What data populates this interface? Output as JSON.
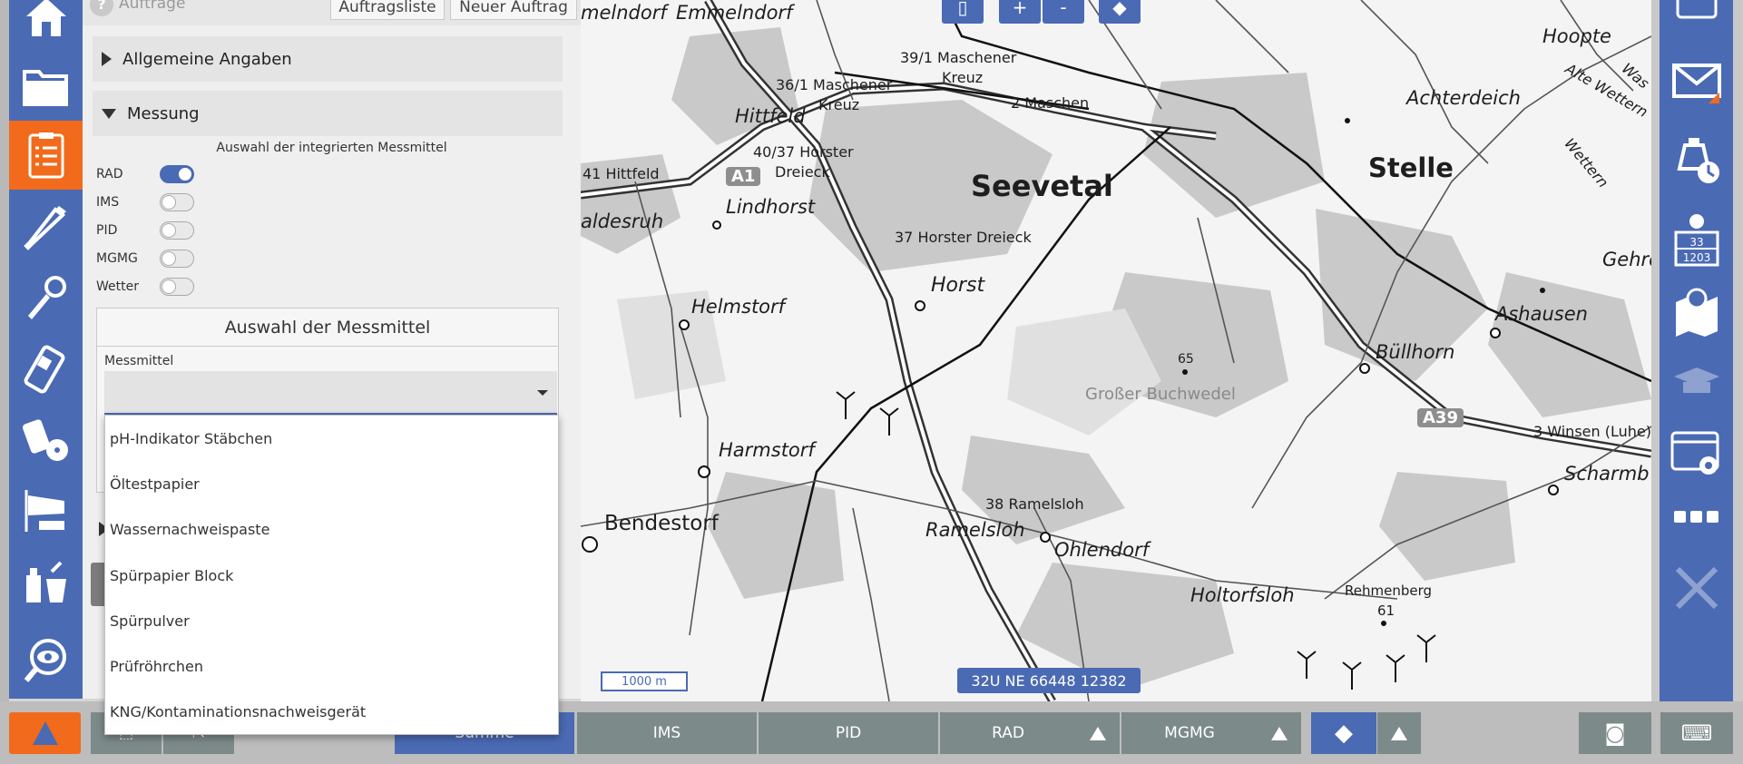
{
  "panel": {
    "title": "Aufträge",
    "tab_list": "Auftragsliste",
    "tab_new": "Neuer Auftrag",
    "section_general": "Allgemeine Angaben",
    "section_measure": "Messung",
    "subtitle": "Auswahl der integrierten Messmittel",
    "toggles": [
      {
        "label": "RAD",
        "on": true
      },
      {
        "label": "IMS",
        "on": false
      },
      {
        "label": "PID",
        "on": false
      },
      {
        "label": "MGMG",
        "on": false
      },
      {
        "label": "Wetter",
        "on": false
      }
    ],
    "box_title": "Auswahl der Messmittel",
    "field_label": "Messmittel",
    "field_value": "",
    "options": [
      "pH-Indikator Stäbchen",
      "Öltestpapier",
      "Wassernachweispaste",
      "Spürpapier Block",
      "Spürpulver",
      "Prüfröhrchen",
      "KNG/Kontaminationsnachweisgerät"
    ]
  },
  "map": {
    "zoom_in": "+",
    "zoom_out": "-",
    "scale": "1000 m",
    "coordinate": "32U NE 66448 12382",
    "places": [
      "melndorf",
      "Emmelndorf",
      "39/1 Maschener",
      "Kreuz",
      "36/1 Maschener",
      "Kreuz",
      "2 Maschen",
      "Hittfeld",
      "40/37 Horster",
      "Dreieck",
      "41 Hittfeld",
      "A1",
      "Lindhorst",
      "Seevetal",
      "aldesruh",
      "37 Horster Dreieck",
      "Horst",
      "Helmstorf",
      "65",
      "Großer Buchwedel",
      "Harmstorf",
      "38 Ramelsloh",
      "Bendestorf",
      "Ramelsloh",
      "Ohlendorf",
      "Holtorfsloh",
      "Rehmenberg",
      "61",
      "Hoopte",
      "Achterdeich",
      "Stelle",
      "Gehrd",
      "Ashausen",
      "Büllhorn",
      "A39",
      "3 Winsen (Luhe)",
      "Scharmb",
      "Alte Wettern",
      "Wettern",
      "Was"
    ]
  },
  "right_rail": {
    "info_numbers_top": "33",
    "info_numbers_bottom": "1203"
  },
  "bottom": {
    "tabs": [
      "Summe",
      "IMS",
      "PID",
      "RAD",
      "MGMG"
    ]
  },
  "colors": {
    "accent_blue": "#4a6ab4",
    "accent_orange": "#f26a1b",
    "bar_grey": "#7d8a8a"
  }
}
